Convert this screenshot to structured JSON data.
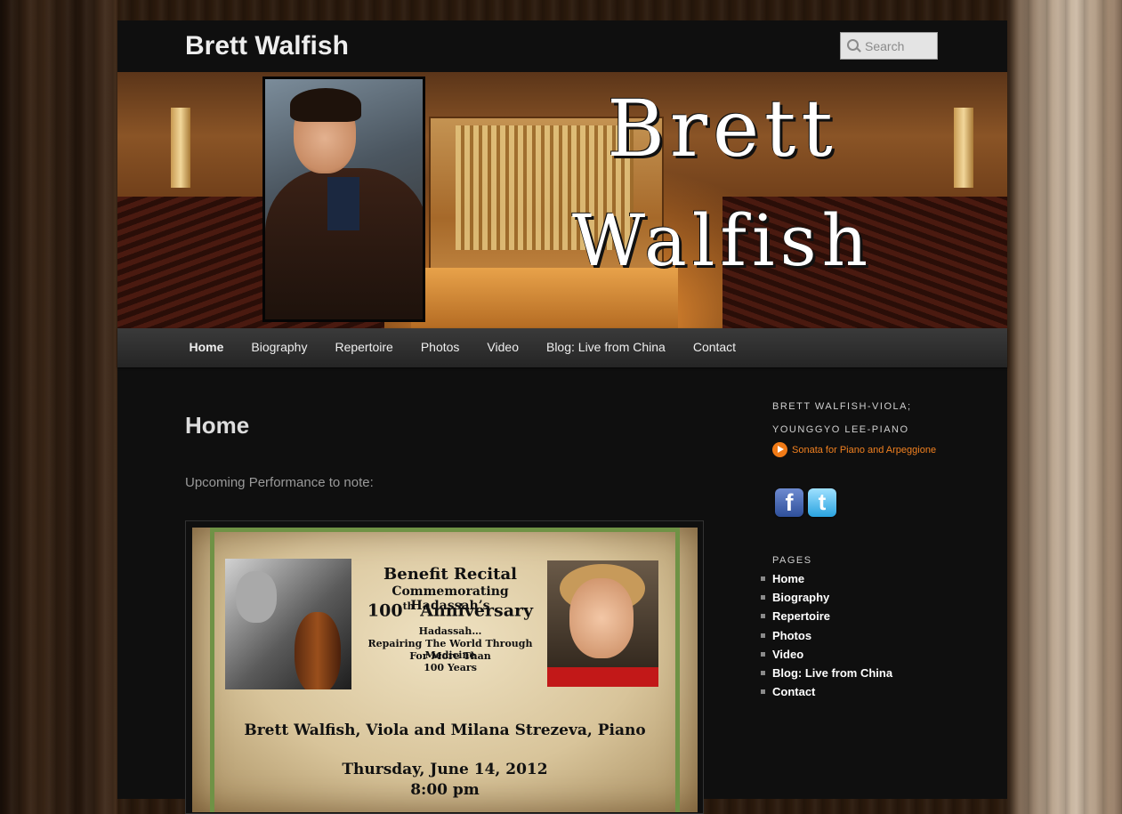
{
  "site": {
    "title": "Brett Walfish",
    "search_placeholder": "Search",
    "banner_line1": "Brett",
    "banner_line2": "Walfish"
  },
  "nav": {
    "items": [
      {
        "label": "Home",
        "current": true
      },
      {
        "label": "Biography"
      },
      {
        "label": "Repertoire"
      },
      {
        "label": "Photos"
      },
      {
        "label": "Video"
      },
      {
        "label": "Blog: Live from China"
      },
      {
        "label": "Contact"
      }
    ]
  },
  "main": {
    "title": "Home",
    "lead": "Upcoming Performance to note:",
    "poster": {
      "title": "Benefit Recital",
      "subtitle": "Commemorating Hadassah’s",
      "anniversary_num": "100",
      "anniversary_sup": "th",
      "anniversary_word": "Anniversary",
      "line1": "Hadassah…",
      "line2": "Repairing The World Through Medicine",
      "line3": "For More Than",
      "line4": "100 Years",
      "performers": "Brett Walfish, Viola and Milana Strezeva, Piano",
      "date": "Thursday, June 14, 2012",
      "time": "8:00 pm"
    }
  },
  "sidebar": {
    "widget1_title_line1": "Brett Walfish-Viola;",
    "widget1_title_line2": "Younggyo Lee-Piano",
    "track_label": "Sonata for Piano and Arpeggione",
    "facebook_glyph": "f",
    "twitter_glyph": "t",
    "pages_title": "Pages",
    "pages": [
      "Home",
      "Biography",
      "Repertoire",
      "Photos",
      "Video",
      "Blog: Live from China",
      "Contact"
    ]
  },
  "colors": {
    "accent": "#f07a16",
    "page_bg": "#0f0f0f",
    "poster_border": "#6f9245"
  }
}
